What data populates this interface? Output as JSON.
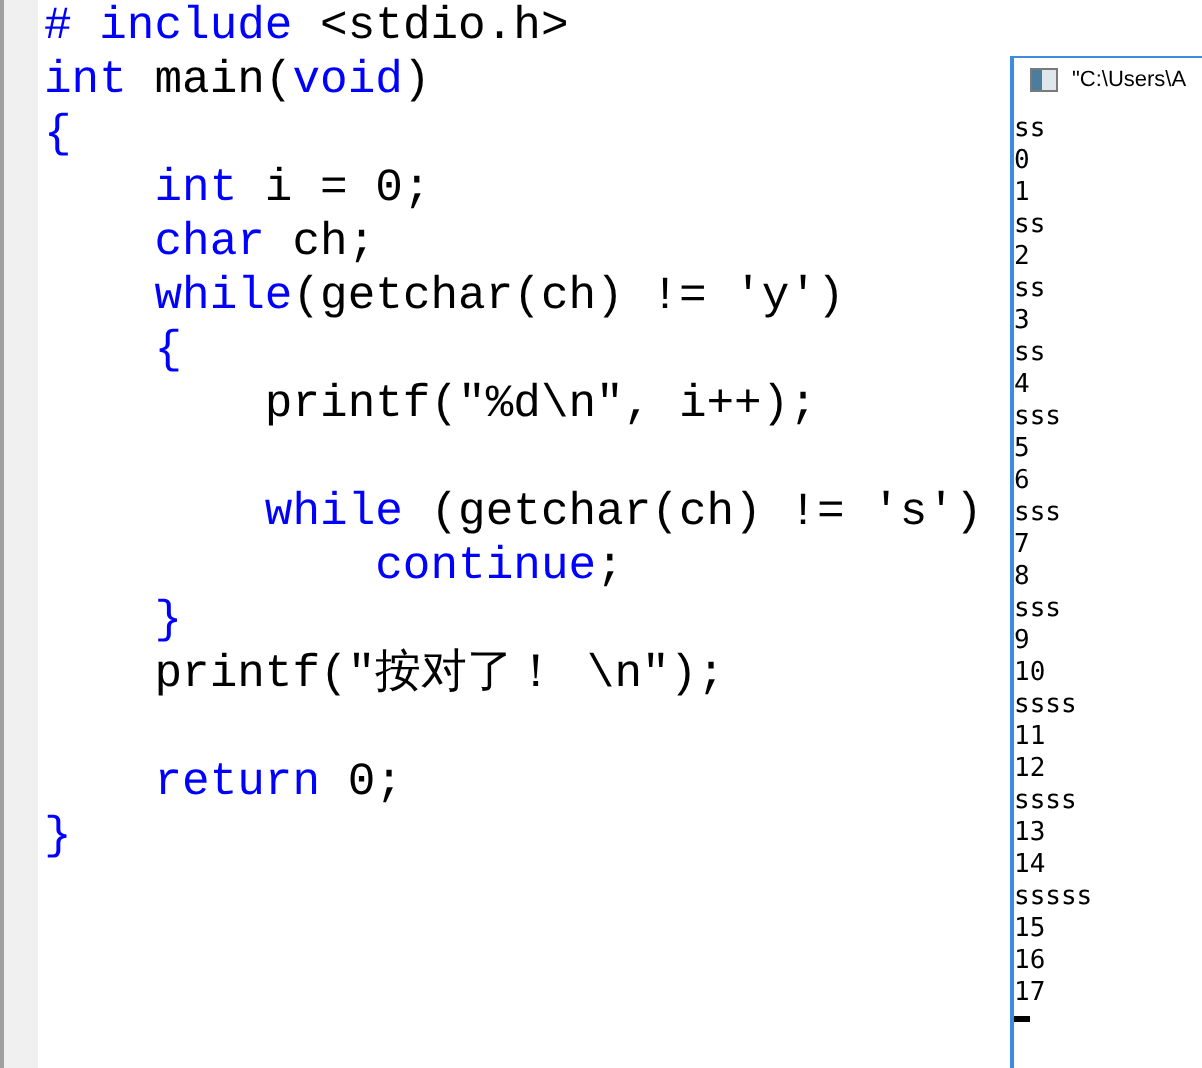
{
  "editor": {
    "lines": [
      {
        "kind": "code",
        "tokens": [
          {
            "text": "# include ",
            "kind": "keyword"
          },
          {
            "text": "<stdio.h>",
            "kind": "plain"
          }
        ]
      },
      {
        "kind": "code",
        "tokens": [
          {
            "text": "int",
            "kind": "keyword"
          },
          {
            "text": " main(",
            "kind": "plain"
          },
          {
            "text": "void",
            "kind": "keyword"
          },
          {
            "text": ")",
            "kind": "plain"
          }
        ]
      },
      {
        "kind": "code",
        "tokens": [
          {
            "text": "{",
            "kind": "keyword"
          }
        ]
      },
      {
        "kind": "code",
        "tokens": [
          {
            "text": "    int",
            "kind": "keyword"
          },
          {
            "text": " i = 0;",
            "kind": "plain"
          }
        ]
      },
      {
        "kind": "code",
        "tokens": [
          {
            "text": "    char",
            "kind": "keyword"
          },
          {
            "text": " ch;",
            "kind": "plain"
          }
        ]
      },
      {
        "kind": "code",
        "tokens": [
          {
            "text": "    while",
            "kind": "keyword"
          },
          {
            "text": "(getchar(ch) != 'y')",
            "kind": "plain"
          }
        ]
      },
      {
        "kind": "code",
        "tokens": [
          {
            "text": "    {",
            "kind": "keyword"
          }
        ]
      },
      {
        "kind": "code",
        "tokens": [
          {
            "text": "        printf(\"%d\\n\", i++);",
            "kind": "plain"
          }
        ]
      },
      {
        "kind": "blank"
      },
      {
        "kind": "code",
        "tokens": [
          {
            "text": "        while",
            "kind": "keyword"
          },
          {
            "text": " (getchar(ch) != 's')",
            "kind": "plain"
          }
        ]
      },
      {
        "kind": "code",
        "tokens": [
          {
            "text": "            continue",
            "kind": "keyword"
          },
          {
            "text": ";",
            "kind": "plain"
          }
        ]
      },
      {
        "kind": "code",
        "tokens": [
          {
            "text": "    }",
            "kind": "keyword"
          }
        ]
      },
      {
        "kind": "code",
        "tokens": [
          {
            "text": "    printf(\"按对了！ \\n\");",
            "kind": "plain"
          }
        ]
      },
      {
        "kind": "blank"
      },
      {
        "kind": "code",
        "tokens": [
          {
            "text": "    return",
            "kind": "keyword"
          },
          {
            "text": " 0;",
            "kind": "plain"
          }
        ]
      },
      {
        "kind": "code",
        "tokens": [
          {
            "text": "}",
            "kind": "keyword"
          }
        ]
      }
    ]
  },
  "console": {
    "title": "\"C:\\Users\\A",
    "output": [
      "ss",
      "0",
      "1",
      "ss",
      "2",
      "ss",
      "3",
      "ss",
      "4",
      "sss",
      "5",
      "6",
      "sss",
      "7",
      "8",
      "sss",
      "9",
      "10",
      "ssss",
      "11",
      "12",
      "ssss",
      "13",
      "14",
      "sssss",
      "15",
      "16",
      "17"
    ]
  }
}
